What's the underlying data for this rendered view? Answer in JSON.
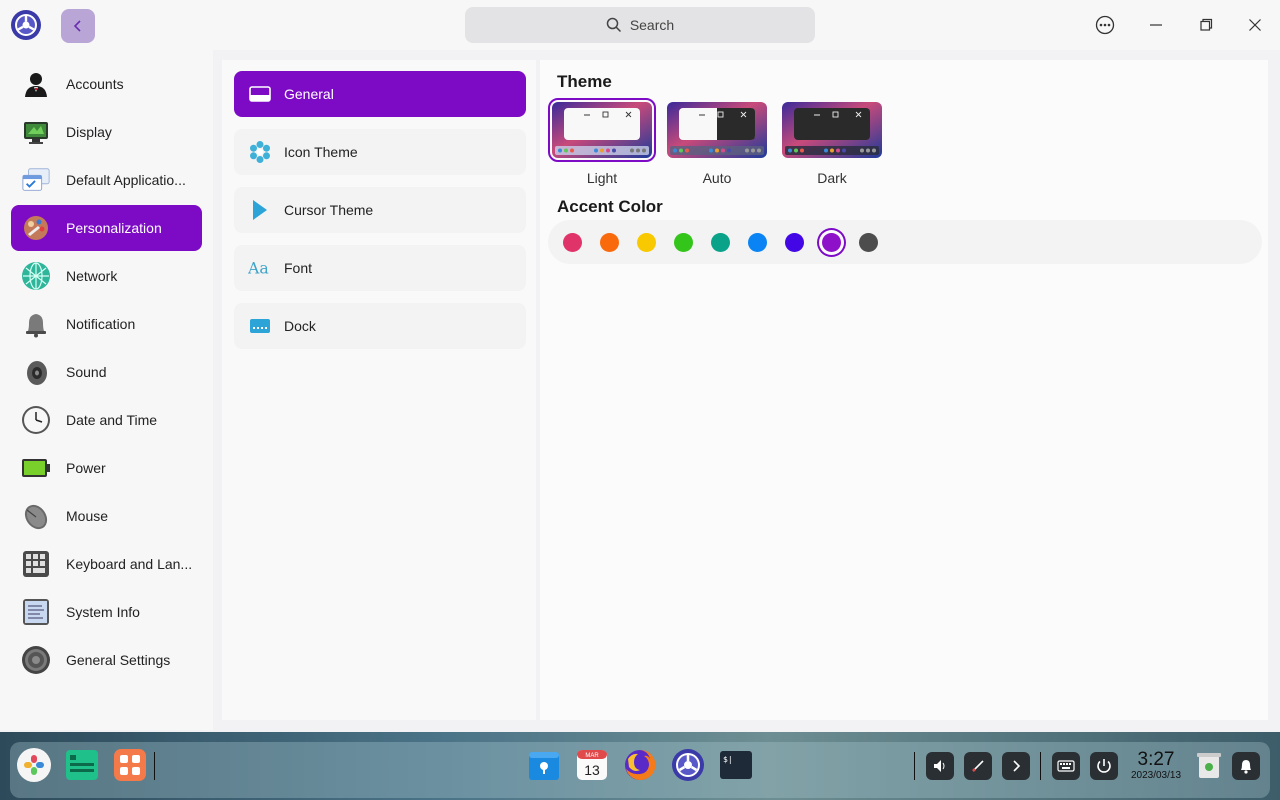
{
  "titlebar": {
    "search_placeholder": "Search"
  },
  "sidebar": {
    "items": [
      {
        "label": "Accounts",
        "icon": "accounts-icon"
      },
      {
        "label": "Display",
        "icon": "display-icon"
      },
      {
        "label": "Default Applicatio...",
        "icon": "default-applications-icon"
      },
      {
        "label": "Personalization",
        "icon": "personalization-icon",
        "active": true
      },
      {
        "label": "Network",
        "icon": "network-icon"
      },
      {
        "label": "Notification",
        "icon": "notification-icon"
      },
      {
        "label": "Sound",
        "icon": "sound-icon"
      },
      {
        "label": "Date and Time",
        "icon": "clock-icon"
      },
      {
        "label": "Power",
        "icon": "battery-icon"
      },
      {
        "label": "Mouse",
        "icon": "mouse-icon"
      },
      {
        "label": "Keyboard and Lan...",
        "icon": "keyboard-icon"
      },
      {
        "label": "System Info",
        "icon": "system-info-icon"
      },
      {
        "label": "General Settings",
        "icon": "gear-icon"
      }
    ]
  },
  "personalization": {
    "items": [
      {
        "label": "General",
        "icon": "window-icon",
        "active": true
      },
      {
        "label": "Icon Theme",
        "icon": "snowflake-icon"
      },
      {
        "label": "Cursor Theme",
        "icon": "cursor-icon"
      },
      {
        "label": "Font",
        "icon": "font-icon"
      },
      {
        "label": "Dock",
        "icon": "dock-icon"
      }
    ]
  },
  "content": {
    "theme_title": "Theme",
    "themes": [
      {
        "label": "Light",
        "selected": true
      },
      {
        "label": "Auto"
      },
      {
        "label": "Dark"
      }
    ],
    "accent_title": "Accent Color",
    "accent_colors": [
      "#e0336a",
      "#f96a0c",
      "#f8c800",
      "#34c51a",
      "#0aa38a",
      "#0a84f5",
      "#4307e6",
      "#8f10c9",
      "#4d4d4d"
    ],
    "accent_selected_index": 7
  },
  "dock": {
    "clock_time": "3:27",
    "clock_date": "2023/03/13",
    "calendar_month": "MAR",
    "calendar_day": "13"
  },
  "colors": {
    "accent": "#7d0bc6"
  }
}
